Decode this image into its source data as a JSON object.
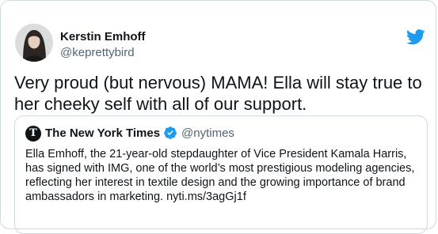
{
  "author": {
    "name": "Kerstin Emhoff",
    "handle": "@keprettybird"
  },
  "icons": {
    "brand": "twitter-bird-icon",
    "verified": "verified-badge-icon",
    "publisher_logo": "nyt-logo-icon",
    "avatar": "profile-photo"
  },
  "colors": {
    "twitter_blue": "#1d9bf0",
    "text": "#0f1419",
    "secondary_text": "#536471",
    "border": "#cfd9de"
  },
  "tweet": {
    "text": "Very proud (but nervous) MAMA!  Ella will stay true to her cheeky self with all of our support."
  },
  "quoted_tweet": {
    "name": "The New York Times",
    "handle": "@nytimes",
    "logo_glyph": "T",
    "text": "Ella Emhoff, the 21-year-old stepdaughter of Vice President Kamala Harris, has signed with IMG, one of the world’s most prestigious modeling agencies, reflecting her interest in textile design and the growing importance of brand ambassadors in marketing. nyti.ms/3agGj1f"
  }
}
